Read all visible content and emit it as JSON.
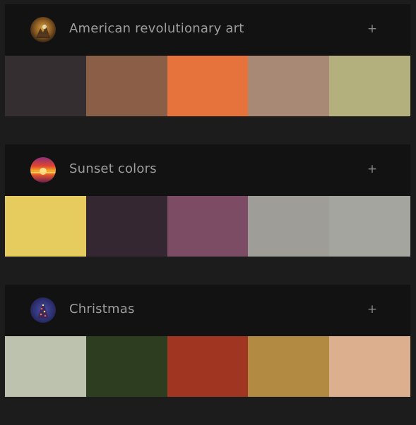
{
  "palettes": [
    {
      "title": "American revolutionary art",
      "add_label": "+",
      "thumbnail": "revolutionary-art-painting-thumbnail",
      "colors": [
        "#352e31",
        "#8a5e47",
        "#e6723c",
        "#a88975",
        "#b3b07e"
      ]
    },
    {
      "title": "Sunset colors",
      "add_label": "+",
      "thumbnail": "sunset-photo-thumbnail",
      "colors": [
        "#e6cb5f",
        "#342731",
        "#7c4c64",
        "#9e9d98",
        "#a4a59f"
      ]
    },
    {
      "title": "Christmas",
      "add_label": "+",
      "thumbnail": "christmas-tree-photo-thumbnail",
      "colors": [
        "#bdc2ae",
        "#2d3e20",
        "#a03621",
        "#b38a42",
        "#dcb08e"
      ]
    }
  ]
}
